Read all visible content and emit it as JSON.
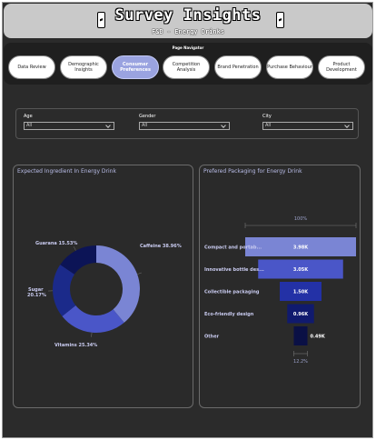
{
  "header": {
    "title": "Survey Insights",
    "subtitle": "F&B - Energy Drinks"
  },
  "nav": {
    "label": "Page Navigator",
    "items": [
      {
        "label": "Data Review",
        "active": false
      },
      {
        "label": "Demographic Insights",
        "active": false
      },
      {
        "label": "Consumer Preferences",
        "active": true
      },
      {
        "label": "Competition Analysis",
        "active": false
      },
      {
        "label": "Brand Penetration",
        "active": false
      },
      {
        "label": "Purchase Behaviour",
        "active": false
      },
      {
        "label": "Product Development",
        "active": false
      }
    ]
  },
  "filters": {
    "age": {
      "label": "Age",
      "value": "All"
    },
    "gender": {
      "label": "Gender",
      "value": "All"
    },
    "city": {
      "label": "City",
      "value": "All"
    }
  },
  "colors": {
    "background": "#2b2b2b",
    "accent": "#9aa3e0",
    "donut": [
      "#7a85d4",
      "#4a56c8",
      "#1b2a8a",
      "#0c1456"
    ],
    "funnel": [
      "#7a85d4",
      "#4a56c8",
      "#2331a6",
      "#101a6e",
      "#0a1045"
    ]
  },
  "chart_data": [
    {
      "type": "pie",
      "title": "Expected Ingredient In Energy Drink",
      "categories": [
        "Caffeine",
        "Vitamins",
        "Sugar",
        "Guarana"
      ],
      "values": [
        38.96,
        25.34,
        20.17,
        15.53
      ],
      "data_labels": [
        "Caffeine 38.96%",
        "Vitamins 25.34%",
        "Sugar 20.17%",
        "Guarana 15.53%"
      ]
    },
    {
      "type": "bar",
      "title": "Prefered Packaging for Energy Drink",
      "categories": [
        "Compact and portab...",
        "Innovative bottle des...",
        "Collectible packaging",
        "Eco-friendly design",
        "Other"
      ],
      "values": [
        3.98,
        3.05,
        1.5,
        0.96,
        0.49
      ],
      "data_labels": [
        "3.98K",
        "3.05K",
        "1.50K",
        "0.96K",
        "0.49K"
      ],
      "top_pct_label": "100%",
      "bottom_pct_label": "12.2%"
    }
  ]
}
